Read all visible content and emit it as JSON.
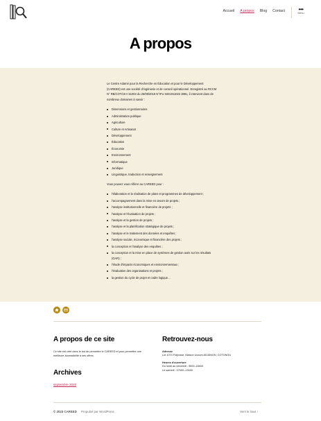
{
  "header": {
    "logo_icon": "magnifier-book-logo-icon",
    "nav": [
      {
        "label": "Accueil",
        "active": false
      },
      {
        "label": "A propos",
        "active": true
      },
      {
        "label": "Blog",
        "active": false
      },
      {
        "label": "Contact",
        "active": false
      }
    ],
    "menu_label": "Menu"
  },
  "page": {
    "title": "A propos",
    "intro": "Le Centre Adamé pour la Recherche en Éducation et pour le Développement (CAREED) est une société d'ingénierie et de conseil opérationnel. Enregistré au RCCM N° RB/COT/19 A 51004 du 26/09/2019 N°IFU 0201911022 3881, il intervient dans de nombreux domaines à savoir :",
    "domains": [
      "Dimensions et gestionnaires",
      "Administration publique",
      "Agriculture",
      "Culture et Artisanat",
      "Développement",
      "Éducation",
      "Économie",
      "Environnement",
      "Informatique",
      "Juridique",
      "Linguistique, traduction et enseignement"
    ],
    "services_intro": "Vous pouvez vous référer au CAREED pour :",
    "services": [
      "l'élaboration et la réalisation de plans et programmes de développement ;",
      "l'accompagnement dans la mise en œuvre de projets ;",
      "l'analyse institutionnelle et financière de projets ;",
      "l'analyse et l'évaluation de projets ;",
      "l'analyse et la gestion de projets ;",
      "l'analyse et la planification stratégique de projets ;",
      "l'analyse et le traitement des données et enquêtes ;",
      "l'analyse sociale, économique et financière des projets ;",
      "la conception et l'analyse des enquêtes ;",
      "la conception et la mise en place de systèmes de gestion axés sur les résultats (GAR) ;",
      "l'étude d'impacts économiques et environnementaux ;",
      "l'évaluation des organisations et projets ;",
      "la gestion du cycle de projet et cadre logique…"
    ]
  },
  "social": [
    {
      "icon": "home-icon"
    },
    {
      "icon": "mail-icon"
    }
  ],
  "footer_widgets": {
    "about_title": "A propos de ce site",
    "about_text": "Ce site est créé dans le but de permettre le CAREED et pour permettre une meilleure accessibilité à ses offres.",
    "archives_title": "Archives",
    "archive_item": "septembre 2020",
    "contact_title": "Retrouvez-nous",
    "address_label": "Adresse",
    "address_value": "Lot 1074 Fidjrossè, Maison Ucoum ADJANON, COTONOU",
    "hours_label": "Heures d'ouverture",
    "hours_weekdays": "Du lundi au vendredi : 9h00–18h00",
    "hours_saturday": "Le samedi : 07h00–13h00"
  },
  "footer": {
    "copyright": "© 2023 CAREED",
    "credit": "Propulsé par WordPress",
    "to_top": "Vers le haut ↑"
  },
  "colors": {
    "accent": "#cd2653",
    "band": "#f5efe0",
    "social": "#b8860b"
  }
}
